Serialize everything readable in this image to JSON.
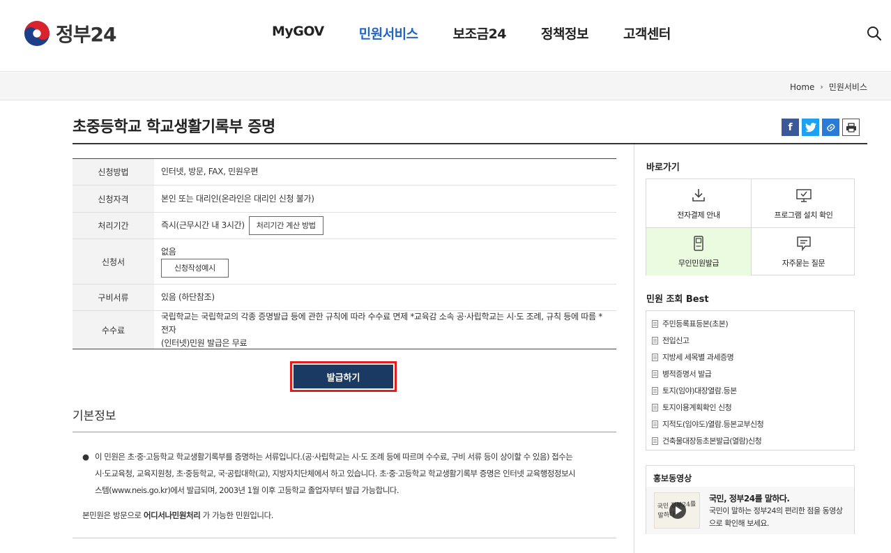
{
  "header": {
    "logo_text": "정부24",
    "nav": [
      "MyGOV",
      "민원서비스",
      "보조금24",
      "정책정보",
      "고객센터"
    ]
  },
  "breadcrumb": {
    "home": "Home",
    "current": "민원서비스"
  },
  "page": {
    "title": "초중등학교 학교생활기록부 증명"
  },
  "info": {
    "method_label": "신청방법",
    "method_value": "인터넷, 방문, FAX, 민원우편",
    "qualification_label": "신청자격",
    "qualification_value": "본인 또는 대리인(온라인은 대리인 신청 불가)",
    "period_label": "처리기간",
    "period_value": "즉시(근무시간 내 3시간)",
    "period_button": "처리기간 계산 방법",
    "form_label": "신청서",
    "form_value": "없음",
    "form_button": "신청작성예시",
    "docs_label": "구비서류",
    "docs_value": "있음 (하단참조)",
    "fee_label": "수수료",
    "fee_value_line1": "국립학교는 국립학교의 각종 증명발급 등에 관한 규칙에 따라 수수료 면제 *교육감 소속 공·사립학교는 시·도 조례, 규칙 등에 따름 * 전자",
    "fee_value_line2": "(인터넷)민원 발급은 무료"
  },
  "issue_button": "발급하기",
  "basic": {
    "title": "기본정보",
    "line1": "이 민원은 초·중·고등학교 학교생활기록부를 증명하는 서류입니다.(공·사립학교는 시·도 조례 등에 따르며 수수료, 구비 서류 등이 상이할 수 있음) 접수는",
    "line2": "시·도교육청, 교육지원청, 초·중등학교, 국·공립대학(교), 지방자치단체에서 하고 있습니다. 초·중·고등학교 학교생활기록부 증명은 인터넷 교육행정정보시",
    "line3": "스템(www.neis.go.kr)에서 발급되며, 2003년 1월 이후 고등학교 졸업자부터 발급 가능합니다.",
    "visit_pre": "본민원은 방문으로 ",
    "visit_bold": "어디서나민원처리",
    "visit_post": " 가 가능한 민원입니다."
  },
  "sidebar": {
    "quick_title": "바로가기",
    "quick": [
      "전자결제 안내",
      "프로그램 설치 확인",
      "무인민원발급",
      "자주묻는 질문"
    ],
    "best_title": "민원 조회 Best",
    "best": [
      "주민등록표등본(초본)",
      "전입신고",
      "지방세 세목별 과세증명",
      "병적증명서 발급",
      "토지(임야)대장열람.등본",
      "토지이용계획확인 신청",
      "지적도(임야도)열람.등본교부신청",
      "건축물대장등초본발급(열람)신청"
    ],
    "promo_title": "홍보동영상",
    "promo_headline": "국민, 정부24를 말하다.",
    "promo_desc": "국민이 말하는 정부24의 편리한 점을 동영상으로 확인해 보세요.",
    "promo_thumb_text": "국민 정부24를 말하다"
  },
  "colors": {
    "accent": "#1f64c9",
    "button": "#1b3a63",
    "highlight_border": "#e02020",
    "quick_highlight": "#eafbe0"
  }
}
